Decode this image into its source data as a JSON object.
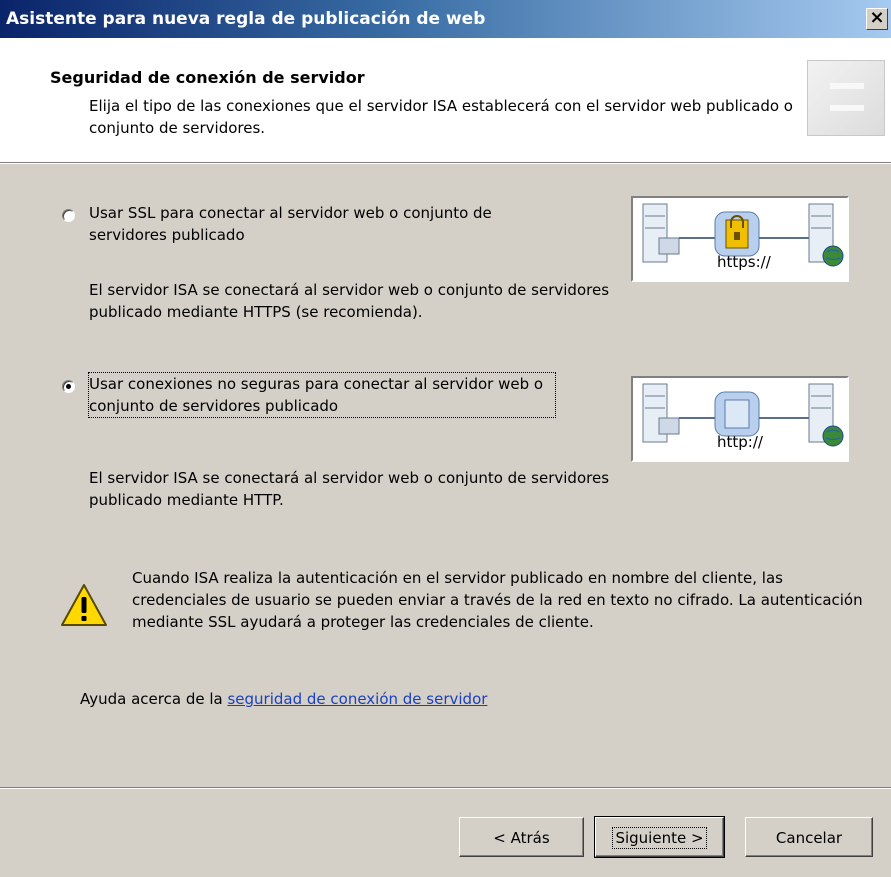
{
  "window": {
    "title": "Asistente para nueva regla de publicación de web",
    "close_label": "×"
  },
  "header": {
    "title": "Seguridad de conexión de servidor",
    "description": "Elija el tipo de las conexiones que el servidor ISA establecerá con el servidor web publicado o conjunto de servidores."
  },
  "options": [
    {
      "label": "Usar SSL para conectar al servidor web o conjunto de servidores publicado",
      "description": "El servidor ISA se conectará al servidor web o conjunto de servidores publicado mediante HTTPS (se recomienda).",
      "checked": false,
      "diagram_url": "https://",
      "diagram_icon": "lock-icon"
    },
    {
      "label": "Usar conexiones no seguras para conectar al servidor web o conjunto de servidores publicado",
      "description": "El servidor ISA se conectará al servidor web o conjunto de servidores publicado mediante HTTP.",
      "checked": true,
      "diagram_url": "http://",
      "diagram_icon": "blank-icon"
    }
  ],
  "warning": {
    "icon": "warning-icon",
    "text": "Cuando ISA realiza la autenticación en el servidor publicado en nombre del cliente, las credenciales de usuario se pueden enviar a través de la red en texto no cifrado. La autenticación mediante SSL ayudará a proteger las credenciales de cliente."
  },
  "help": {
    "prefix": "Ayuda acerca de la ",
    "link_text": "seguridad de conexión de servidor"
  },
  "buttons": {
    "back": "< Atrás",
    "next": "Siguiente >",
    "cancel": "Cancelar"
  },
  "colors": {
    "title_gradient_start": "#0a246a",
    "title_gradient_end": "#a6caf0",
    "link": "#1a3fc0",
    "dialog_bg": "#d4d0c8"
  }
}
